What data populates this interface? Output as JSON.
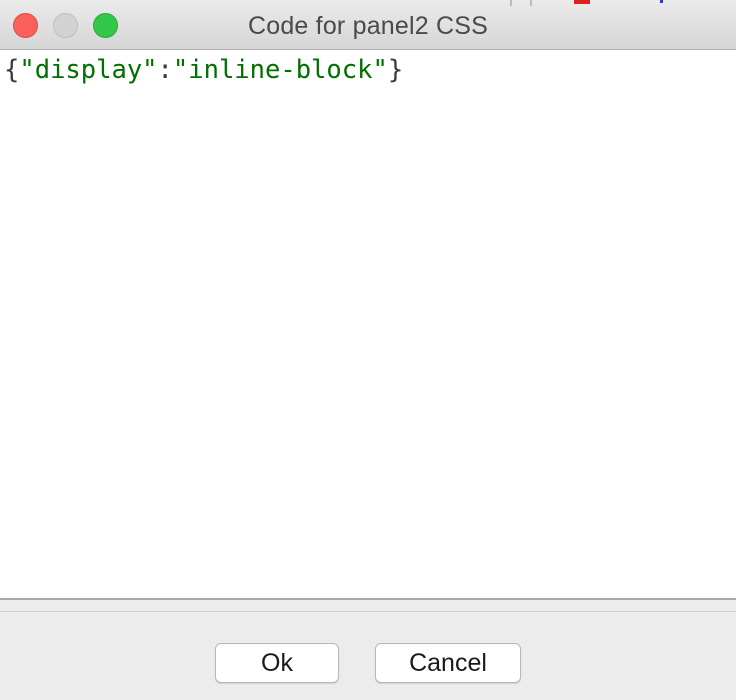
{
  "window": {
    "title": "Code for panel2 CSS"
  },
  "editor": {
    "tokens": {
      "open_brace": "{",
      "key": "\"display\"",
      "colon": ":",
      "value": "\"inline-block\"",
      "close_brace": "}"
    },
    "colors": {
      "string": "#007000",
      "punctuation": "#3a3a3a"
    }
  },
  "buttons": {
    "ok_label": "Ok",
    "cancel_label": "Cancel"
  }
}
